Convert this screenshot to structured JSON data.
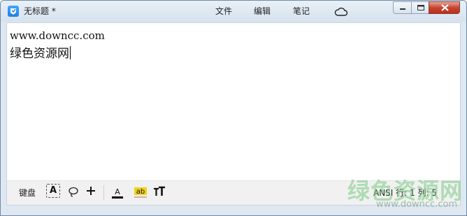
{
  "window": {
    "title": "无标题 *",
    "app_icon": "app-notebook-icon",
    "menu": [
      {
        "label": "文件"
      },
      {
        "label": "编辑"
      },
      {
        "label": "笔记"
      }
    ],
    "cloud_icon": "cloud-icon",
    "controls": [
      "minimize-icon",
      "maximize-icon",
      "close-icon"
    ]
  },
  "editor": {
    "lines": [
      "www.downcc.com",
      "绿色资源网"
    ]
  },
  "toolbar": {
    "keyboard_label": "键盘",
    "font_label": "A",
    "icons": [
      "lasso-icon",
      "plus-icon",
      "font-color-icon",
      "highlight-icon",
      "text-size-icon"
    ],
    "highlight_label": "ab",
    "status": "ANSI 行: 1 列: 5"
  },
  "watermark": {
    "cn": "绿色资源网",
    "en": "www.downcc.com"
  },
  "colors": {
    "accent": "#1b7fe6",
    "close_button": "#c7442f",
    "highlight": "#f3d21a",
    "font_color_bar": "#000000"
  }
}
